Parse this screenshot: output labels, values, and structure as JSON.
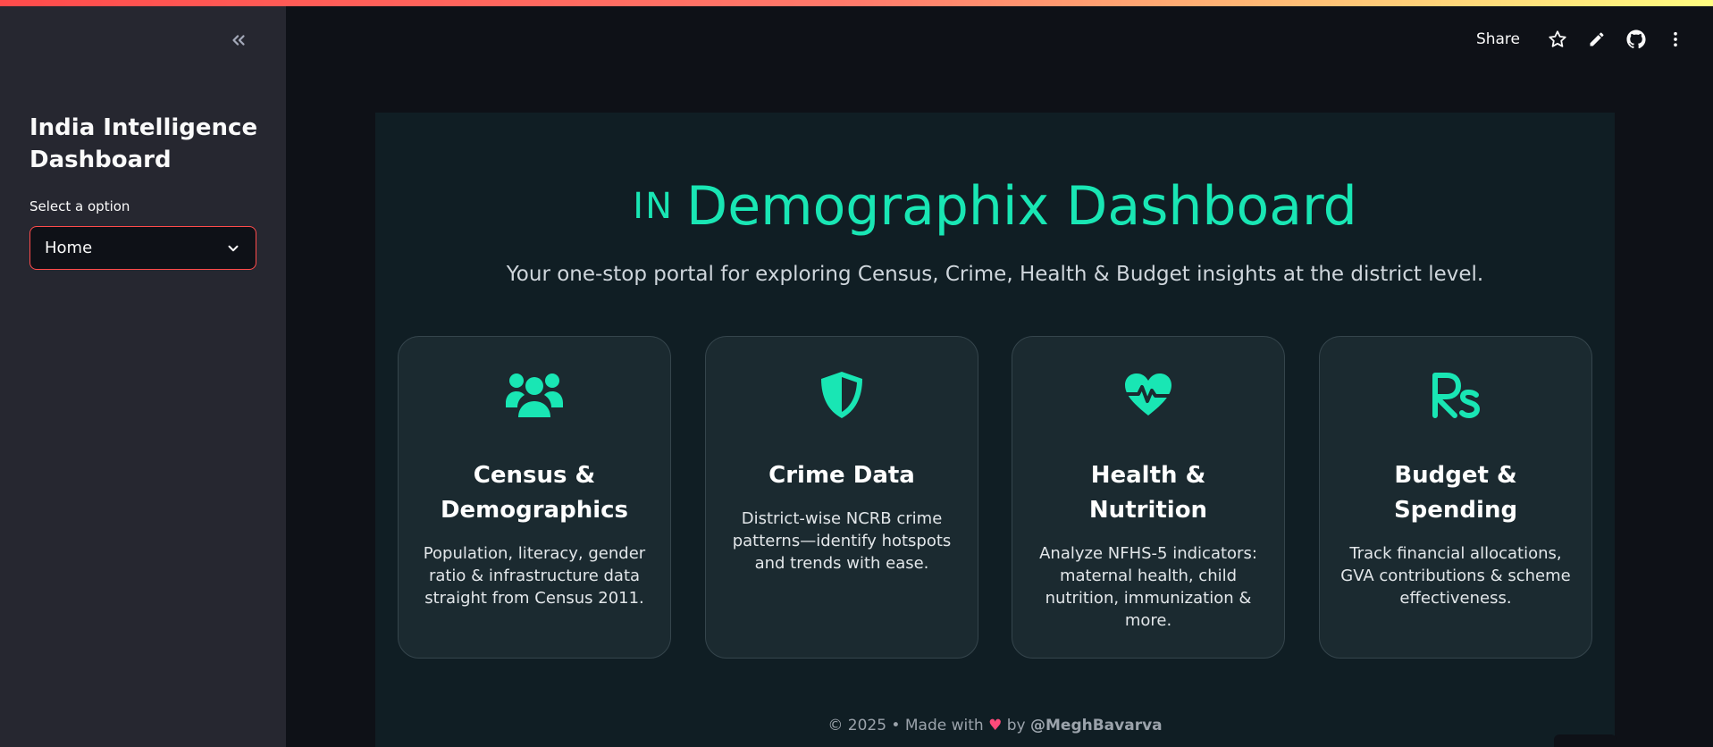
{
  "sidebar": {
    "title": "India Intelligence Dashboard",
    "select_label": "Select a option",
    "select_value": "Home"
  },
  "header": {
    "share_label": "Share"
  },
  "hero": {
    "flag_text": "IN",
    "title": "Demographix Dashboard",
    "subtitle": "Your one-stop portal for exploring Census, Crime, Health & Budget insights at the district level."
  },
  "cards": [
    {
      "icon": "people-group-icon",
      "title": "Census & Demographics",
      "desc": "Population, literacy, gender ratio & infrastructure data straight from Census 2011."
    },
    {
      "icon": "shield-icon",
      "title": "Crime Data",
      "desc": "District-wise NCRB crime patterns—identify hotspots and trends with ease."
    },
    {
      "icon": "heart-pulse-icon",
      "title": "Health & Nutrition",
      "desc": "Analyze NFHS-5 indicators: maternal health, child nutrition, immunization & more."
    },
    {
      "icon": "rupee-icon",
      "title": "Budget & Spending",
      "desc": "Track financial allocations, GVA contributions & scheme effectiveness."
    }
  ],
  "footer": {
    "prefix": "© 2025 • Made with",
    "heart": "♥",
    "by": "by",
    "author": "@MeghBavarva"
  },
  "colors": {
    "accent": "#19e6b4",
    "sidebar_bg": "#262730",
    "main_bg": "#0e1117",
    "hero_bg": "#101e24",
    "card_bg": "#1b2a30",
    "select_border": "#ff4b4b"
  }
}
